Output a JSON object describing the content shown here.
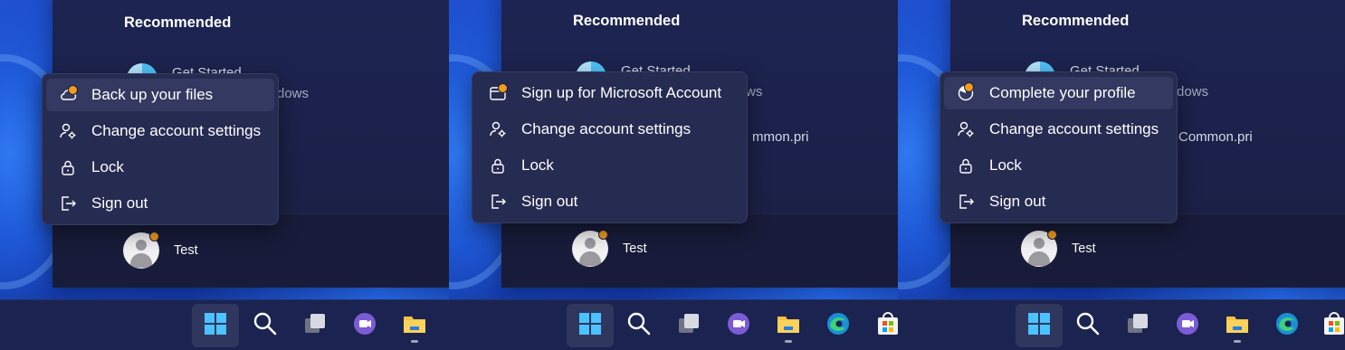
{
  "recommended_title": "Recommended",
  "user_name": "Test",
  "panels": [
    {
      "rec_visible": [
        "Get Started",
        "dows"
      ],
      "rec_second": "",
      "menu": [
        {
          "label": "Back up your files",
          "icon": "cloud-icon",
          "badge": true,
          "highlight": true
        },
        {
          "label": "Change account settings",
          "icon": "person-gear-icon",
          "badge": false,
          "highlight": false
        },
        {
          "label": "Lock",
          "icon": "lock-icon",
          "badge": false,
          "highlight": false
        },
        {
          "label": "Sign out",
          "icon": "sign-out-icon",
          "badge": false,
          "highlight": false
        }
      ]
    },
    {
      "rec_visible": [
        "Get Started",
        "ws"
      ],
      "rec_second": "mmon.pri",
      "menu": [
        {
          "label": "Sign up for Microsoft Account",
          "icon": "account-card-icon",
          "badge": true,
          "highlight": false
        },
        {
          "label": "Change account settings",
          "icon": "person-gear-icon",
          "badge": false,
          "highlight": false
        },
        {
          "label": "Lock",
          "icon": "lock-icon",
          "badge": false,
          "highlight": false
        },
        {
          "label": "Sign out",
          "icon": "sign-out-icon",
          "badge": false,
          "highlight": false
        }
      ]
    },
    {
      "rec_visible": [
        "Get Started",
        "dows"
      ],
      "rec_second": "Common.pri",
      "menu": [
        {
          "label": "Complete your profile",
          "icon": "progress-circle-icon",
          "badge": true,
          "highlight": true
        },
        {
          "label": "Change account settings",
          "icon": "person-gear-icon",
          "badge": false,
          "highlight": false
        },
        {
          "label": "Lock",
          "icon": "lock-icon",
          "badge": false,
          "highlight": false
        },
        {
          "label": "Sign out",
          "icon": "sign-out-icon",
          "badge": false,
          "highlight": false
        }
      ]
    }
  ],
  "taskbar_icons": [
    "start-icon",
    "search-icon",
    "task-view-icon",
    "chat-icon",
    "file-explorer-icon",
    "edge-icon",
    "store-icon"
  ],
  "colors": {
    "badge": "#f29b1d",
    "menu_bg": "#262b52",
    "taskbar_bg": "#1b2450"
  }
}
